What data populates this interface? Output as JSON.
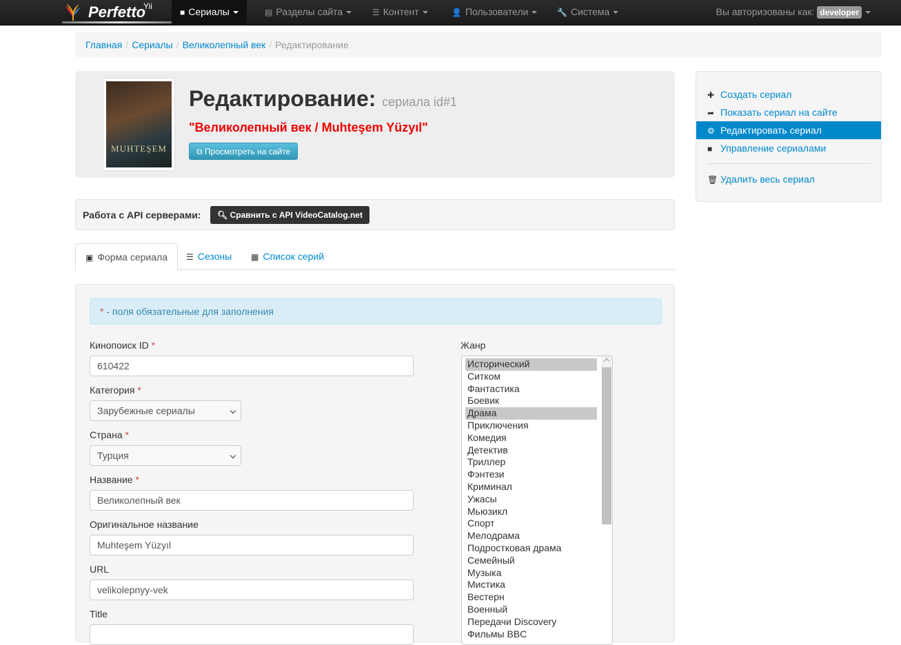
{
  "navbar": {
    "brand": "Perfetto",
    "brand_sup": "Yii",
    "items": [
      {
        "label": "Сериалы",
        "icon": "video-icon"
      },
      {
        "label": "Разделы сайта",
        "icon": "list-alt-icon"
      },
      {
        "label": "Контент",
        "icon": "list-icon"
      },
      {
        "label": "Пользователи",
        "icon": "user-icon"
      },
      {
        "label": "Система",
        "icon": "wrench-icon"
      }
    ],
    "user_prefix": "Вы авторизованы как:",
    "username": "developer"
  },
  "breadcrumb": [
    "Главная",
    "Сериалы",
    "Великолепный век",
    "Редактирование"
  ],
  "hero": {
    "title": "Редактирование:",
    "subtitle": "сериала id#1",
    "name": "\"Великолепный век / Muhteşem Yüzyıl\"",
    "view_button": "Просмотреть на сайте",
    "poster_text": "MUHTEŞEM"
  },
  "sidebar": {
    "items": [
      "Создать сериал",
      "Показать сериал на сайте",
      "Редактировать сериал",
      "Управление сериалами"
    ],
    "delete": "Удалить весь сериал"
  },
  "api": {
    "label": "Работа с API серверами:",
    "button": "Сравнить с API VideoCatalog.net"
  },
  "tabs": [
    "Форма сериала",
    "Сезоны",
    "Список серий"
  ],
  "form": {
    "alert_star": "*",
    "alert": " - поля обязательные для заполнения",
    "fields": [
      {
        "label": "Кинопоиск ID",
        "value": "610422"
      },
      {
        "label": "Категория",
        "value": "Зарубежные сериалы"
      },
      {
        "label": "Страна",
        "value": "Турция"
      },
      {
        "label": "Название",
        "value": "Великолепный век"
      },
      {
        "label": "Оригинальное название",
        "value": "Muhteşem Yüzyıl"
      },
      {
        "label": "URL",
        "value": "velikolepnyy-vek"
      },
      {
        "label": "Title",
        "value": ""
      }
    ],
    "required_mark": "*",
    "genre_label": "Жанр",
    "genres": [
      "Исторический",
      "Ситком",
      "Фантастика",
      "Боевик",
      "Драма",
      "Приключения",
      "Комедия",
      "Детектив",
      "Триллер",
      "Фэнтези",
      "Криминал",
      "Ужасы",
      "Мьюзикл",
      "Спорт",
      "Мелодрама",
      "Подростковая драма",
      "Семейный",
      "Музыка",
      "Мистика",
      "Вестерн",
      "Военный",
      "Передачи Discovery",
      "Фильмы BBC"
    ],
    "selected_genres": [
      "Исторический",
      "Драма"
    ]
  }
}
